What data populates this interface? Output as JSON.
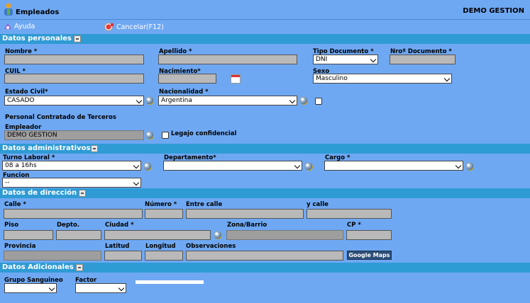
{
  "header": {
    "title": "Empleados",
    "company": "DEMO GESTION"
  },
  "toolbar": {
    "help": "Ayuda",
    "cancel": "Cancelar(F12)"
  },
  "sections": {
    "personal": "Datos personales",
    "admin": "Datos administrativos",
    "address": "Datos de dirección",
    "extra": "Datos Adicionales"
  },
  "personal": {
    "nombre_label": "Nombre *",
    "apellido_label": "Apellido *",
    "tipo_doc_label": "Tipo Documento *",
    "tipo_doc_value": "DNI",
    "nro_doc_label": "Nroº Documento *",
    "cuil_label": "CUIL *",
    "nacimiento_label": "Nacimiento*",
    "sexo_label": "Sexo",
    "sexo_value": "Masculino",
    "estado_civil_label": "Estado Civil*",
    "estado_civil_value": "CASADO",
    "nacionalidad_label": "Nacionalidad *",
    "nacionalidad_value": "Argentina",
    "terceros_label": "Personal Contratado de Terceros",
    "empleador_label": "Empleador",
    "empleador_value": "DEMO GESTION",
    "legajo_label": "Legajo confidencial"
  },
  "admin": {
    "turno_label": "Turno Laboral *",
    "turno_value": "08 a 16hs",
    "departamento_label": "Departamento*",
    "cargo_label": "Cargo *",
    "funcion_label": "Funcion",
    "funcion_value": "--"
  },
  "address": {
    "calle_label": "Calle *",
    "numero_label": "Número *",
    "entre_calle_label": "Entre calle",
    "y_calle_label": "y calle",
    "piso_label": "Piso",
    "depto_label": "Depto.",
    "ciudad_label": "Ciudad *",
    "zona_label": "Zona/Barrio",
    "cp_label": "CP *",
    "provincia_label": "Provincia",
    "latitud_label": "Latitud",
    "longitud_label": "Longitud",
    "observaciones_label": "Observaciones",
    "gmaps_label": "Google Maps"
  },
  "extra": {
    "grupo_label": "Grupo Sanguineo",
    "factor_label": "Factor"
  }
}
